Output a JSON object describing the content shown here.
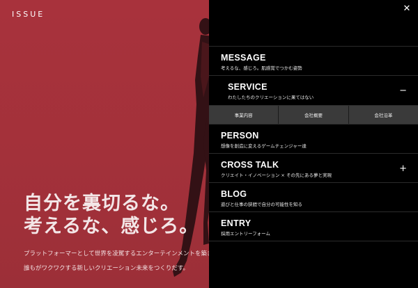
{
  "brand": {
    "logo": "ISSUE"
  },
  "hero": {
    "headline_line1": "自分を裏切るな。",
    "headline_line2": "考えるな、感じろ。",
    "sub_line1": "プラットフォーマーとして世界を凌駕するエンターテインメントを築き、",
    "sub_line2": "誰もがワクワクする新しいクリエーション未来をつくりだす。"
  },
  "menu": {
    "close_icon": "close-icon",
    "items": [
      {
        "title": "MESSAGE",
        "desc": "考えるな、感じろ。肌感覚でつかむ姿勢",
        "toggle": ""
      },
      {
        "title": "SERVICE",
        "desc": "わたしたちのクリエーションに果てはない",
        "toggle": "−"
      },
      {
        "title": "PERSON",
        "desc": "想像を創造に変えるゲームチェンジャー達",
        "toggle": ""
      },
      {
        "title": "CROSS TALK",
        "desc": "クリエイト・イノベーション × その先にある夢と実現",
        "toggle": "+"
      },
      {
        "title": "BLOG",
        "desc": "遊びと仕事の狭間で自分の可能性を知る",
        "toggle": ""
      },
      {
        "title": "ENTRY",
        "desc": "採用エントリーフォーム",
        "toggle": ""
      }
    ],
    "service_sub": [
      "事業内容",
      "会社概要",
      "会社沿革"
    ]
  },
  "colors": {
    "hero_bg": "#a8323c",
    "menu_bg": "#000000",
    "submenu_bg": "#3a3a3a"
  }
}
